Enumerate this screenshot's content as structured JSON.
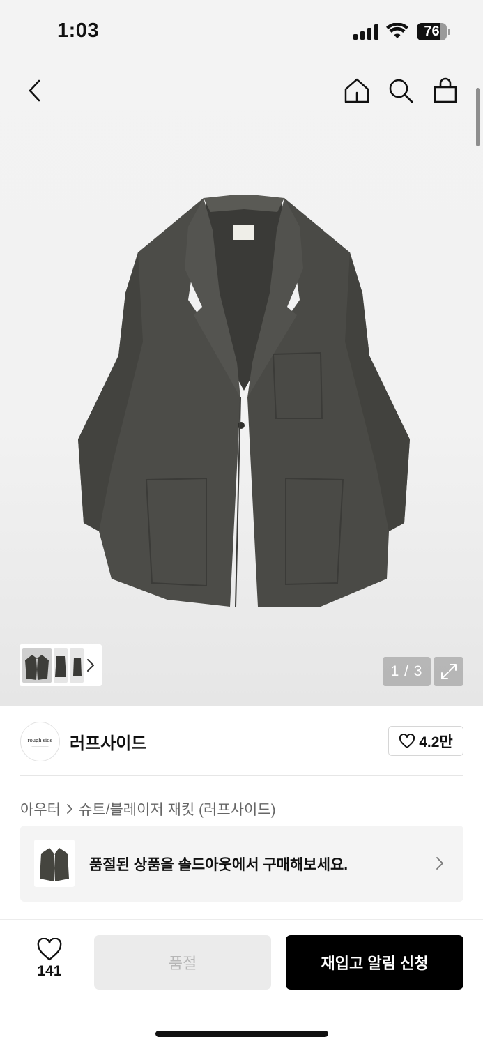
{
  "status_bar": {
    "time": "1:03",
    "battery": "76",
    "battery_level": 0.76
  },
  "header": {
    "back_icon": "chevron-left-icon",
    "icons": [
      "home-icon",
      "search-icon",
      "shopping-bag-icon"
    ]
  },
  "gallery": {
    "counter": "1 / 3",
    "thumbnails": 3,
    "expand_icon": "expand-icon"
  },
  "brand": {
    "logo_text": "rough side",
    "name": "러프사이드",
    "likes": "4.2만"
  },
  "breadcrumb": {
    "items": [
      "아우터",
      "슈트/블레이저 재킷 (러프사이드)"
    ]
  },
  "soldout_banner": {
    "text": "품절된 상품을 솔드아웃에서 구매해보세요."
  },
  "bottom_bar": {
    "wish_count": "141",
    "soldout_label": "품절",
    "restock_label": "재입고 알림 신청"
  },
  "colors": {
    "background": "#f2f2f2",
    "jacket": "#4a4a46",
    "primary_button": "#000000",
    "disabled_button": "#ebebeb"
  }
}
